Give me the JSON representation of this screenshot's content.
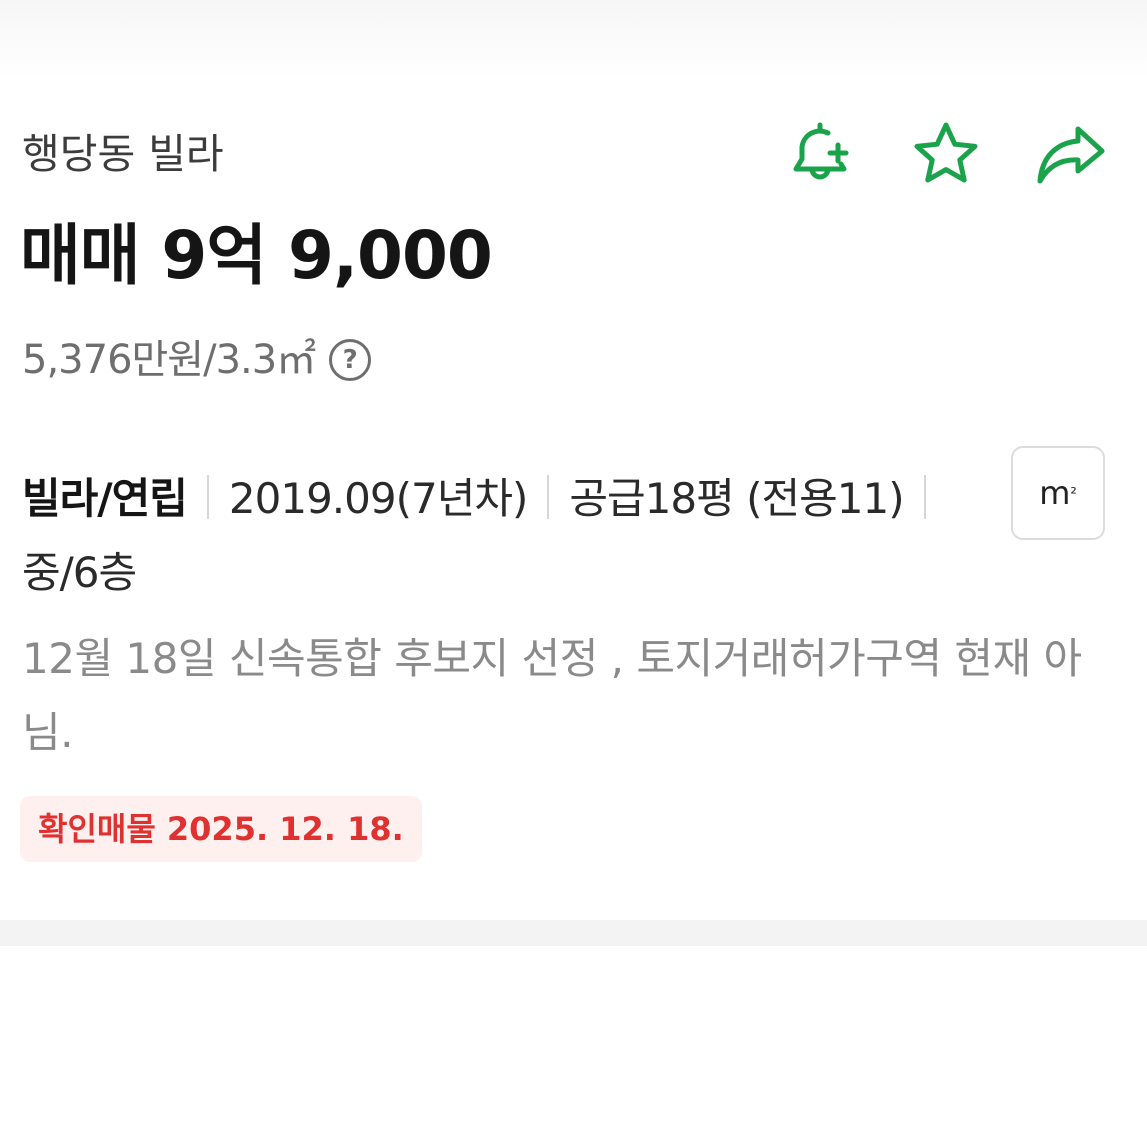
{
  "listing": {
    "location": "행당동 빌라",
    "price": "매매 9억 9,000",
    "unit_price": "5,376만원/3.3㎡",
    "specs": {
      "type": "빌라/연립",
      "built": "2019.09(7년차)",
      "area": "공급18평 (전용11)",
      "floor": "중/6층"
    },
    "unit_toggle_label": "m",
    "unit_toggle_sup": "²",
    "description": "12월 18일 신속통합 후보지 선정 , 토지거래허가구역 현재 아님.",
    "verified_label": "확인매물 2025. 12. 18.",
    "help_glyph": "?"
  },
  "actions": [
    {
      "name": "bell-plus-icon"
    },
    {
      "name": "star-icon"
    },
    {
      "name": "share-icon"
    }
  ],
  "colors": {
    "accent_green": "#1aa34a",
    "verified_red": "#e03131",
    "verified_bg": "#fff0f0"
  }
}
